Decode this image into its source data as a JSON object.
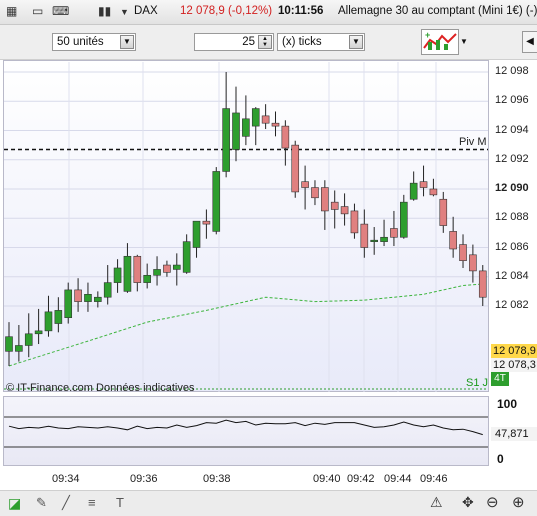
{
  "header": {
    "instrument": "DAX",
    "price_change": "12 078,9 (-0,12%)",
    "time": "10:11:56",
    "description": "Allemagne 30 au comptant (Mini 1€) (-)"
  },
  "toolbar": {
    "quantity": "50 unités",
    "tick_count": "25",
    "tick_unit": "(x) ticks"
  },
  "chart": {
    "watermark": "© IT-Finance.com  Données indicatives",
    "pivot_label": "Piv M",
    "support_label": "S1 J",
    "last_price_badge": "12 078,9",
    "second_price_badge": "12 078,3",
    "fourt_badge": "4T",
    "bull_color": "#2e9e2e",
    "bear_color": "#e08080"
  },
  "oscillator": {
    "level_top": "100",
    "value": "47,871",
    "level_bottom": "0"
  },
  "chart_data": {
    "type": "candlestick",
    "y_ticks": [
      "12 098",
      "12 096",
      "12 094",
      "12 092",
      "12 090",
      "12 088",
      "12 086",
      "12 084",
      "12 082"
    ],
    "ylim": [
      12077.8,
      12099.0
    ],
    "x_ticks": [
      "09:34",
      "09:36",
      "09:38",
      "09:40",
      "09:42",
      "09:44",
      "09:46"
    ],
    "pivot_level": 12092.7,
    "support_level": 12077.8,
    "candles": [
      {
        "o": 12078.9,
        "h": 12080.9,
        "l": 12077.9,
        "c": 12079.9
      },
      {
        "o": 12078.9,
        "h": 12080.7,
        "l": 12078.2,
        "c": 12079.3
      },
      {
        "o": 12079.3,
        "h": 12081.5,
        "l": 12078.5,
        "c": 12080.1
      },
      {
        "o": 12080.1,
        "h": 12081.8,
        "l": 12079.4,
        "c": 12080.3
      },
      {
        "o": 12080.3,
        "h": 12082.7,
        "l": 12079.9,
        "c": 12081.6
      },
      {
        "o": 12080.8,
        "h": 12082.6,
        "l": 12080.2,
        "c": 12081.7
      },
      {
        "o": 12081.2,
        "h": 12083.6,
        "l": 12080.8,
        "c": 12083.1
      },
      {
        "o": 12083.1,
        "h": 12083.9,
        "l": 12081.6,
        "c": 12082.3
      },
      {
        "o": 12082.3,
        "h": 12083.6,
        "l": 12081.6,
        "c": 12082.8
      },
      {
        "o": 12082.3,
        "h": 12083.0,
        "l": 12081.9,
        "c": 12082.6
      },
      {
        "o": 12082.6,
        "h": 12084.8,
        "l": 12082.1,
        "c": 12083.6
      },
      {
        "o": 12083.6,
        "h": 12085.2,
        "l": 12082.9,
        "c": 12084.6
      },
      {
        "o": 12083.0,
        "h": 12086.3,
        "l": 12082.9,
        "c": 12085.4
      },
      {
        "o": 12085.4,
        "h": 12085.5,
        "l": 12083.0,
        "c": 12083.6
      },
      {
        "o": 12083.6,
        "h": 12084.9,
        "l": 12083.2,
        "c": 12084.1
      },
      {
        "o": 12084.1,
        "h": 12085.4,
        "l": 12083.4,
        "c": 12084.5
      },
      {
        "o": 12084.8,
        "h": 12085.1,
        "l": 12084.0,
        "c": 12084.3
      },
      {
        "o": 12084.5,
        "h": 12085.6,
        "l": 12083.4,
        "c": 12084.8
      },
      {
        "o": 12084.3,
        "h": 12086.9,
        "l": 12084.2,
        "c": 12086.4
      },
      {
        "o": 12086.0,
        "h": 12087.7,
        "l": 12085.3,
        "c": 12087.8
      },
      {
        "o": 12087.8,
        "h": 12088.6,
        "l": 12086.6,
        "c": 12087.6
      },
      {
        "o": 12087.1,
        "h": 12091.5,
        "l": 12086.9,
        "c": 12091.2
      },
      {
        "o": 12091.2,
        "h": 12098.0,
        "l": 12090.8,
        "c": 12095.5
      },
      {
        "o": 12092.7,
        "h": 12097.0,
        "l": 12091.9,
        "c": 12095.2
      },
      {
        "o": 12093.6,
        "h": 12096.4,
        "l": 12093.0,
        "c": 12094.8
      },
      {
        "o": 12094.3,
        "h": 12095.6,
        "l": 12093.0,
        "c": 12095.5
      },
      {
        "o": 12095.0,
        "h": 12095.8,
        "l": 12094.1,
        "c": 12094.5
      },
      {
        "o": 12094.5,
        "h": 12095.3,
        "l": 12093.6,
        "c": 12094.3
      },
      {
        "o": 12094.3,
        "h": 12094.7,
        "l": 12091.6,
        "c": 12092.8
      },
      {
        "o": 12093.0,
        "h": 12093.3,
        "l": 12089.4,
        "c": 12089.8
      },
      {
        "o": 12090.5,
        "h": 12091.6,
        "l": 12088.6,
        "c": 12090.1
      },
      {
        "o": 12090.1,
        "h": 12090.6,
        "l": 12088.9,
        "c": 12089.4
      },
      {
        "o": 12090.1,
        "h": 12090.6,
        "l": 12087.2,
        "c": 12088.5
      },
      {
        "o": 12089.1,
        "h": 12089.9,
        "l": 12087.3,
        "c": 12088.6
      },
      {
        "o": 12088.8,
        "h": 12089.7,
        "l": 12087.5,
        "c": 12088.3
      },
      {
        "o": 12088.5,
        "h": 12089.0,
        "l": 12086.6,
        "c": 12087.0
      },
      {
        "o": 12087.6,
        "h": 12088.6,
        "l": 12085.3,
        "c": 12086.0
      },
      {
        "o": 12086.5,
        "h": 12087.4,
        "l": 12085.5,
        "c": 12086.5
      },
      {
        "o": 12086.4,
        "h": 12087.9,
        "l": 12086.1,
        "c": 12086.7
      },
      {
        "o": 12087.3,
        "h": 12088.5,
        "l": 12086.1,
        "c": 12086.7
      },
      {
        "o": 12086.7,
        "h": 12089.6,
        "l": 12086.6,
        "c": 12089.1
      },
      {
        "o": 12089.3,
        "h": 12091.2,
        "l": 12089.2,
        "c": 12090.4
      },
      {
        "o": 12090.5,
        "h": 12091.6,
        "l": 12089.5,
        "c": 12090.1
      },
      {
        "o": 12090.0,
        "h": 12090.7,
        "l": 12089.5,
        "c": 12089.6
      },
      {
        "o": 12089.3,
        "h": 12089.8,
        "l": 12087.0,
        "c": 12087.5
      },
      {
        "o": 12087.1,
        "h": 12088.1,
        "l": 12085.3,
        "c": 12085.9
      },
      {
        "o": 12086.2,
        "h": 12086.9,
        "l": 12084.6,
        "c": 12085.1
      },
      {
        "o": 12085.5,
        "h": 12086.2,
        "l": 12083.6,
        "c": 12084.4
      },
      {
        "o": 12084.4,
        "h": 12084.8,
        "l": 12082.0,
        "c": 12082.6
      }
    ],
    "moving_average": [
      [
        0,
        12077.9
      ],
      [
        8,
        12079.6
      ],
      [
        14,
        12080.9
      ],
      [
        20,
        12081.7
      ],
      [
        26,
        12082.6
      ],
      [
        31,
        12082.3
      ],
      [
        36,
        12082.4
      ],
      [
        42,
        12082.8
      ],
      [
        46,
        12083.4
      ],
      [
        48,
        12083.5
      ]
    ],
    "oscillator_points": [
      78,
      74,
      76,
      75,
      78,
      75,
      74,
      77,
      76,
      75,
      77,
      75,
      72,
      78,
      74,
      76,
      75,
      80,
      76,
      79,
      84,
      83,
      88,
      84,
      86,
      80,
      83,
      82,
      82,
      84,
      79,
      83,
      81,
      84,
      84,
      84,
      80,
      76,
      77,
      80,
      85,
      80,
      77,
      80,
      75,
      72,
      73,
      69,
      64
    ]
  }
}
